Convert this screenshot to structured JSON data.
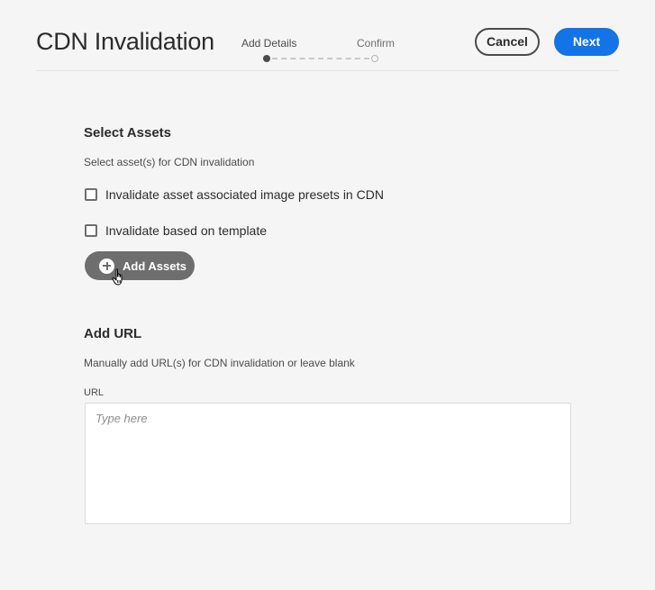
{
  "header": {
    "title": "CDN Invalidation",
    "steps": [
      {
        "label": "Add Details",
        "state": "current"
      },
      {
        "label": "Confirm",
        "state": "upcoming"
      }
    ],
    "cancel_label": "Cancel",
    "next_label": "Next"
  },
  "select_assets": {
    "title": "Select Assets",
    "description": "Select asset(s) for CDN invalidation",
    "checkboxes": [
      {
        "label": "Invalidate asset associated image presets in CDN",
        "checked": false
      },
      {
        "label": "Invalidate based on template",
        "checked": false
      }
    ],
    "add_assets_label": "Add Assets",
    "add_assets_icon": "plus-circle-icon"
  },
  "add_url": {
    "title": "Add URL",
    "description": "Manually add URL(s) for CDN invalidation or leave blank",
    "field_label": "URL",
    "placeholder": "Type here",
    "value": ""
  },
  "colors": {
    "primary": "#1473e6",
    "background": "#f5f5f5",
    "text": "#2c2c2c",
    "secondary_button": "#6e6e6e"
  }
}
